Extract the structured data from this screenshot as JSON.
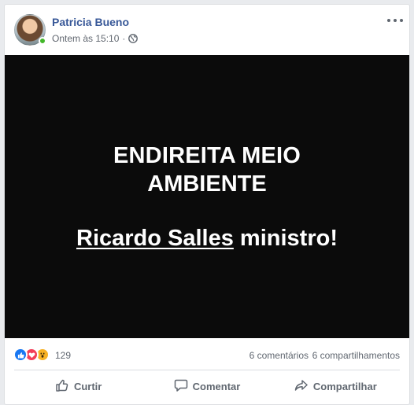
{
  "post": {
    "author": "Patricia Bueno",
    "timestamp": "Ontem às 15:10",
    "separator": "·",
    "privacy_icon": "globe-icon",
    "menu_icon": "more-horizontal-icon"
  },
  "image": {
    "line1": "ENDIREITA MEIO",
    "line2": "AMBIENTE",
    "line3_underlined": "Ricardo Salles",
    "line3_rest": " ministro!",
    "background": "#0b0b0b",
    "text_color": "#ffffff"
  },
  "reactions": {
    "icons": [
      "like-icon",
      "love-icon",
      "wow-icon"
    ],
    "count": "129",
    "comments": "6 comentários",
    "shares": "6 compartilhamentos"
  },
  "actions": {
    "like": "Curtir",
    "comment": "Comentar",
    "share": "Compartilhar"
  },
  "colors": {
    "author_link": "#385898",
    "meta_text": "#616770",
    "like_blue": "#1877f2",
    "love_red": "#f33e58",
    "wow_yellow": "#f7b125",
    "online_green": "#42b72a"
  }
}
